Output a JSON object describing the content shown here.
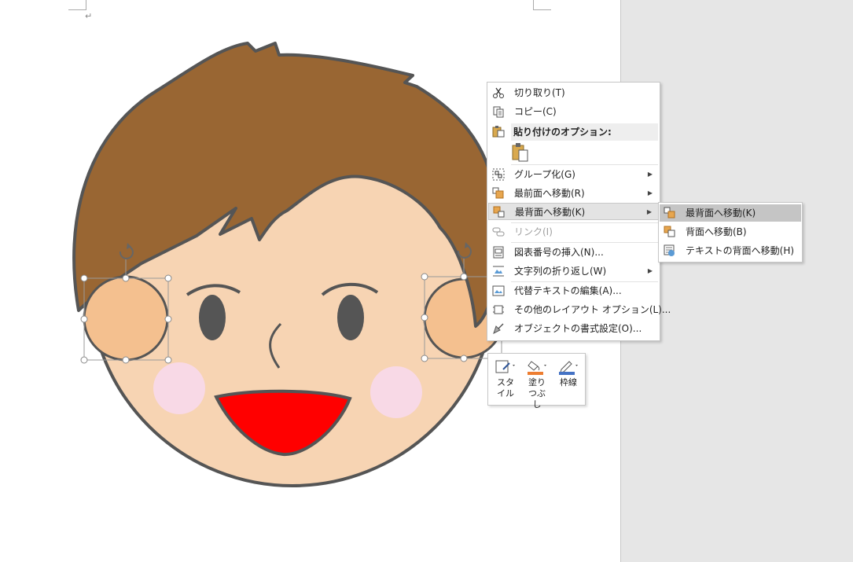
{
  "document": {
    "paragraph_mark": "↵"
  },
  "context_menu": {
    "items": [
      {
        "label": "切り取り(T)",
        "icon": "scissors-icon"
      },
      {
        "label": "コピー(C)",
        "icon": "copy-icon"
      },
      {
        "label": "貼り付けのオプション:",
        "icon": "paste-icon"
      },
      {
        "label": "グループ化(G)",
        "icon": "group-icon",
        "submenu": true
      },
      {
        "label": "最前面へ移動(R)",
        "icon": "bring-to-front-icon",
        "submenu": true
      },
      {
        "label": "最背面へ移動(K)",
        "icon": "send-to-back-icon",
        "submenu": true
      },
      {
        "label": "リンク(I)",
        "icon": "link-icon",
        "disabled": true
      },
      {
        "label": "図表番号の挿入(N)...",
        "icon": "caption-icon"
      },
      {
        "label": "文字列の折り返し(W)",
        "icon": "wrap-text-icon",
        "submenu": true
      },
      {
        "label": "代替テキストの編集(A)...",
        "icon": "alt-text-icon"
      },
      {
        "label": "その他のレイアウト オプション(L)...",
        "icon": "layout-options-icon"
      },
      {
        "label": "オブジェクトの書式設定(O)...",
        "icon": "format-object-icon"
      }
    ]
  },
  "submenu": {
    "items": [
      {
        "label": "最背面へ移動(K)",
        "icon": "send-to-back-icon"
      },
      {
        "label": "背面へ移動(B)",
        "icon": "send-backward-icon"
      },
      {
        "label": "テキストの背面へ移動(H)",
        "icon": "behind-text-icon"
      }
    ]
  },
  "mini_toolbar": {
    "style_label": "スタイル",
    "fill_label": "塗りつぶし",
    "outline_label": "枠線"
  },
  "colors": {
    "hair": "#996633",
    "skin": "#f7d4b3",
    "ear": "#f4c08f",
    "cheek": "#f8d9e6",
    "mouth": "#ff0000",
    "outline": "#555555",
    "fill_accent": "#ed7d31",
    "outline_accent": "#4472c4"
  }
}
